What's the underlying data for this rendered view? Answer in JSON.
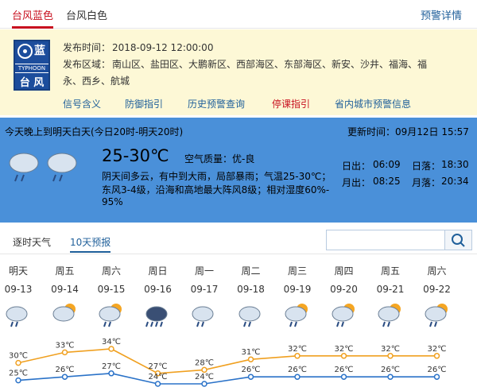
{
  "tabs": {
    "blue": "台风蓝色",
    "white": "台风白色",
    "detail": "预警详情"
  },
  "badge": {
    "level": "蓝",
    "eng": "TYPHOON",
    "cn": "台 风"
  },
  "warning": {
    "time_label": "发布时间：",
    "time": "2018-09-12 12:00:00",
    "area_label": "发布区域：",
    "area_line1": "南山区、盐田区、大鹏新区、西部海区、东部海区、新安、沙井、福海、福",
    "area_line2": "永、西乡、航城"
  },
  "links": [
    "信号含义",
    "防御指引",
    "历史预警查询",
    "停课指引",
    "省内城市预警信息"
  ],
  "forecast": {
    "period": "今天晚上到明天白天(今日20时-明天20时)",
    "update": "更新时间：09月12日 15:57",
    "temp": "25-30℃",
    "aqi": "空气质量：优-良",
    "desc1": "阴天间多云，有中到大雨，局部暴雨；气温25-30℃；",
    "desc2": "东风3-4级，沿海和高地最大阵风8级；相对湿度60%-",
    "desc3": "95%",
    "sunrise_label": "日出：",
    "sunrise": "06:09",
    "sunset_label": "日落：",
    "sunset": "18:30",
    "moonrise_label": "月出：",
    "moonrise": "08:25",
    "moonset_label": "月落：",
    "moonset": "20:34"
  },
  "tabs2": {
    "hourly": "逐时天气",
    "ten": "10天预报"
  },
  "days": [
    {
      "day": "明天",
      "date": "09-13",
      "icon": "rain-cloud-icon",
      "high": "30℃",
      "low": "25℃"
    },
    {
      "day": "周五",
      "date": "09-14",
      "icon": "sun-cloud-icon",
      "high": "33℃",
      "low": "26℃"
    },
    {
      "day": "周六",
      "date": "09-15",
      "icon": "sun-rain-icon",
      "high": "34℃",
      "low": "27℃"
    },
    {
      "day": "周日",
      "date": "09-16",
      "icon": "heavy-rain-icon",
      "high": "27℃",
      "low": "24℃"
    },
    {
      "day": "周一",
      "date": "09-17",
      "icon": "rain-cloud-icon",
      "high": "28℃",
      "low": "24℃"
    },
    {
      "day": "周二",
      "date": "09-18",
      "icon": "rain-cloud-icon",
      "high": "31℃",
      "low": "26℃"
    },
    {
      "day": "周三",
      "date": "09-19",
      "icon": "sun-rain-icon",
      "high": "32℃",
      "low": "26℃"
    },
    {
      "day": "周四",
      "date": "09-20",
      "icon": "sun-rain-icon",
      "high": "32℃",
      "low": "26℃"
    },
    {
      "day": "周五",
      "date": "09-21",
      "icon": "sun-rain-icon",
      "high": "32℃",
      "low": "26℃"
    },
    {
      "day": "周六",
      "date": "09-22",
      "icon": "sun-rain-icon",
      "high": "32℃",
      "low": "26℃"
    }
  ],
  "chart_data": {
    "type": "line",
    "categories": [
      "09-13",
      "09-14",
      "09-15",
      "09-16",
      "09-17",
      "09-18",
      "09-19",
      "09-20",
      "09-21",
      "09-22"
    ],
    "series": [
      {
        "values": [
          30,
          33,
          34,
          27,
          28,
          31,
          32,
          32,
          32,
          32
        ],
        "color": "#f0a020"
      },
      {
        "values": [
          25,
          26,
          27,
          24,
          24,
          26,
          26,
          26,
          26,
          26
        ],
        "color": "#2a72c8"
      }
    ]
  },
  "colors": {
    "accent": "#c8101f",
    "link": "#1f5f9a",
    "panel": "#4a90d9",
    "warnbg": "#fdf8d6"
  }
}
